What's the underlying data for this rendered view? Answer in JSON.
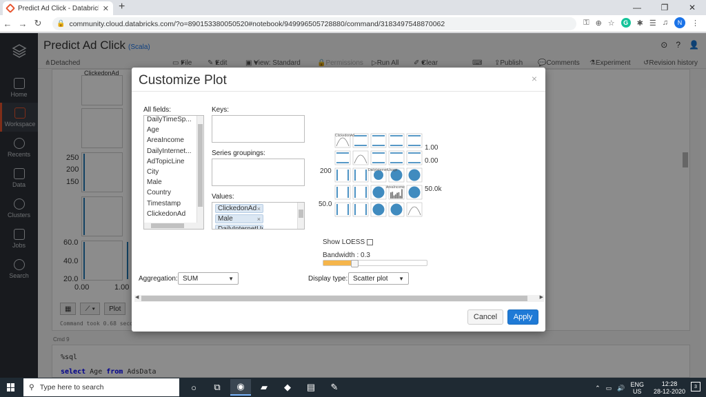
{
  "browser": {
    "tab_title": "Predict Ad Click - Databricks Com",
    "url": "community.cloud.databricks.com/?o=890153380050520#notebook/949996505728880/command/3183497548870062",
    "profile_initial": "N",
    "grammarly_letter": "G"
  },
  "sidebar": {
    "items": [
      {
        "label": "Home"
      },
      {
        "label": "Workspace"
      },
      {
        "label": "Recents"
      },
      {
        "label": "Data"
      },
      {
        "label": "Clusters"
      },
      {
        "label": "Jobs"
      },
      {
        "label": "Search"
      }
    ]
  },
  "notebook": {
    "title": "Predict Ad Click",
    "language": "(Scala)",
    "toolbar": {
      "cluster": "Detached",
      "file": "File",
      "edit": "Edit",
      "view": "View: Standard",
      "permissions": "Permissions",
      "run_all": "Run All",
      "clear": "Clear",
      "publish": "Publish",
      "comments": "Comments",
      "experiment": "Experiment",
      "revision_history": "Revision history"
    },
    "bg_labels": {
      "top_plot": "ClickedonAd",
      "y250": "250",
      "y200": "200",
      "y150": "150",
      "y60": "60.0",
      "y40": "40.0",
      "y20": "20.0",
      "x0": "0.00",
      "x1": "1.00",
      "plot_btn": "Plot"
    },
    "cell_footer": "Command took 0.68 seconds",
    "cmd_label": "Cmd 9",
    "next_cell": {
      "magic": "%sql",
      "kw_select": "select",
      "col": "Age",
      "kw_from": "from",
      "table": "AdsData"
    }
  },
  "modal": {
    "title": "Customize Plot",
    "close": "×",
    "all_fields_label": "All fields:",
    "all_fields": [
      "DailyTimeSp...",
      "Age",
      "AreaIncome",
      "DailyInternet...",
      "AdTopicLine",
      "City",
      "Male",
      "Country",
      "Timestamp",
      "ClickedonAd"
    ],
    "keys_label": "Keys:",
    "series_label": "Series groupings:",
    "values_label": "Values:",
    "values": [
      "ClickedonAd",
      "Male",
      "DailyInternetUs"
    ],
    "preview": {
      "lbl_clicked": "ClickedonAd",
      "lbl_daily": "DailyInternetUsage",
      "lbl_area": "AreaIncome",
      "axis_100": "1.00",
      "axis_000": "0.00",
      "axis_200": "200",
      "axis_50k": "50.0k",
      "axis_50": "50.0"
    },
    "show_loess_label": "Show LOESS",
    "bandwidth_label": "Bandwidth : 0.3",
    "bandwidth": 0.3,
    "aggregation_label": "Aggregation:",
    "aggregation_value": "SUM",
    "display_type_label": "Display type:",
    "display_type_value": "Scatter plot",
    "cancel": "Cancel",
    "apply": "Apply"
  },
  "taskbar": {
    "search_placeholder": "Type here to search",
    "lang_top": "ENG",
    "lang_bottom": "US",
    "time": "12:28",
    "date": "28-12-2020",
    "notif_count": "3"
  },
  "colors": {
    "accent": "#1f7ad6",
    "sidebar_bg": "#2c3138",
    "scatter_blue": "#1f77b4",
    "slider_fill": "#f5b54b"
  }
}
